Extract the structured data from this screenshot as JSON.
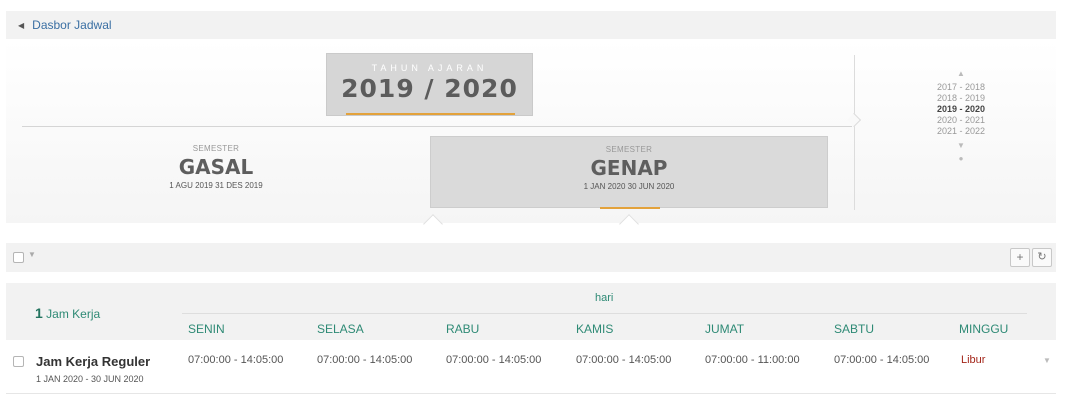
{
  "breadcrumb": {
    "label": "Dasbor Jadwal"
  },
  "academic_year": {
    "label": "TAHUN AJARAN",
    "value": "2019 / 2020"
  },
  "semesters": [
    {
      "label": "SEMESTER",
      "name": "GASAL",
      "dates": "1 AGU 2019 31 DES 2019",
      "active": false
    },
    {
      "label": "SEMESTER",
      "name": "GENAP",
      "dates": "1 JAN 2020 30 JUN 2020",
      "active": true
    }
  ],
  "year_list": {
    "items": [
      "2017 - 2018",
      "2018 - 2019",
      "2019 - 2020",
      "2020 - 2021",
      "2021 - 2022"
    ],
    "active": "2019 - 2020",
    "icons": {
      "up": "chevron-up-icon",
      "down": "chevron-down-icon",
      "dot": "dot-icon"
    }
  },
  "toolbar": {
    "add_icon": "plus-icon",
    "refresh_icon": "refresh-icon"
  },
  "table": {
    "count": "1",
    "title": "Jam Kerja",
    "group_header": "hari",
    "days": [
      "SENIN",
      "SELASA",
      "RABU",
      "KAMIS",
      "JUMAT",
      "SABTU",
      "MINGGU"
    ],
    "rows": [
      {
        "name": "Jam Kerja Reguler",
        "range": "1 JAN 2020 - 30 JUN 2020",
        "times": [
          "07:00:00 - 14:05:00",
          "07:00:00 - 14:05:00",
          "07:00:00 - 14:05:00",
          "07:00:00 - 14:05:00",
          "07:00:00 - 11:00:00",
          "07:00:00 - 14:05:00",
          "Libur"
        ]
      }
    ]
  },
  "colors": {
    "accent": "#e3a23b",
    "header_text": "#2e8a75",
    "libur": "#a4261a",
    "link": "#3a6fa3"
  }
}
